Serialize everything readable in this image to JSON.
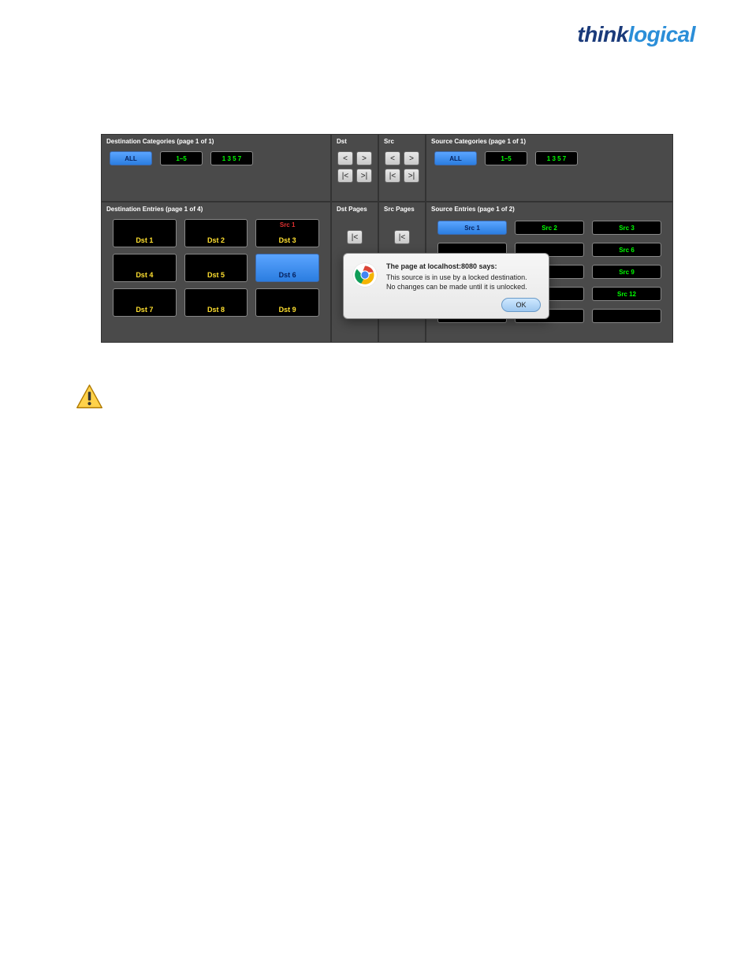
{
  "logo": {
    "part1": "think",
    "part2": "logical"
  },
  "panels": {
    "dest_cat_title": "Destination Categories (page 1 of 1)",
    "dst_title": "Dst",
    "src_title": "Src",
    "src_cat_title": "Source Categories (page 1 of 1)",
    "dest_entries_title": "Destination Entries (page 1 of 4)",
    "dst_pages_title": "Dst Pages",
    "src_pages_title": "Src Pages",
    "src_entries_title": "Source Entries (page 1 of 2)"
  },
  "cats": {
    "all": "ALL",
    "range": "1–5",
    "odd": "1 3 5 7"
  },
  "nav": {
    "prev": "<",
    "next": ">",
    "first": "|<",
    "last": ">|"
  },
  "dst_entries": [
    {
      "src_tag": "",
      "label": ""
    },
    {
      "src_tag": "",
      "label": ""
    },
    {
      "src_tag": "Src 1",
      "label": ""
    },
    {
      "src_tag": "",
      "label": "Dst 1"
    },
    {
      "src_tag": "",
      "label": "Dst 2"
    },
    {
      "src_tag": "",
      "label": "Dst 3"
    },
    {
      "src_tag": "",
      "label": "Dst 4"
    },
    {
      "src_tag": "",
      "label": "Dst 5"
    },
    {
      "src_tag": "",
      "label": "Dst 6"
    },
    {
      "src_tag": "",
      "label": "Dst 7"
    },
    {
      "src_tag": "",
      "label": "Dst 8"
    },
    {
      "src_tag": "",
      "label": "Dst 9"
    }
  ],
  "dst_rows": [
    [
      "",
      "",
      ""
    ],
    [
      "Dst 1",
      "Dst 2",
      "Dst 3"
    ],
    [
      "",
      "",
      ""
    ],
    [
      "Dst 4",
      "Dst 5",
      "Dst 6"
    ],
    [
      "",
      "",
      ""
    ],
    [
      "Dst 7",
      "Dst 8",
      "Dst 9"
    ]
  ],
  "dst_upper_src": [
    "",
    "",
    "Src 1"
  ],
  "src_entries": [
    "Src 1",
    "Src 2",
    "Src 3",
    "",
    "",
    "Src 6",
    "",
    "",
    "Src 9",
    "",
    "",
    "Src 12",
    "",
    "",
    ""
  ],
  "dialog": {
    "header": "The page at localhost:8080 says:",
    "line1": "This source is in use by a locked destination.",
    "line2": "No changes can be made until it is unlocked.",
    "ok": "OK"
  }
}
